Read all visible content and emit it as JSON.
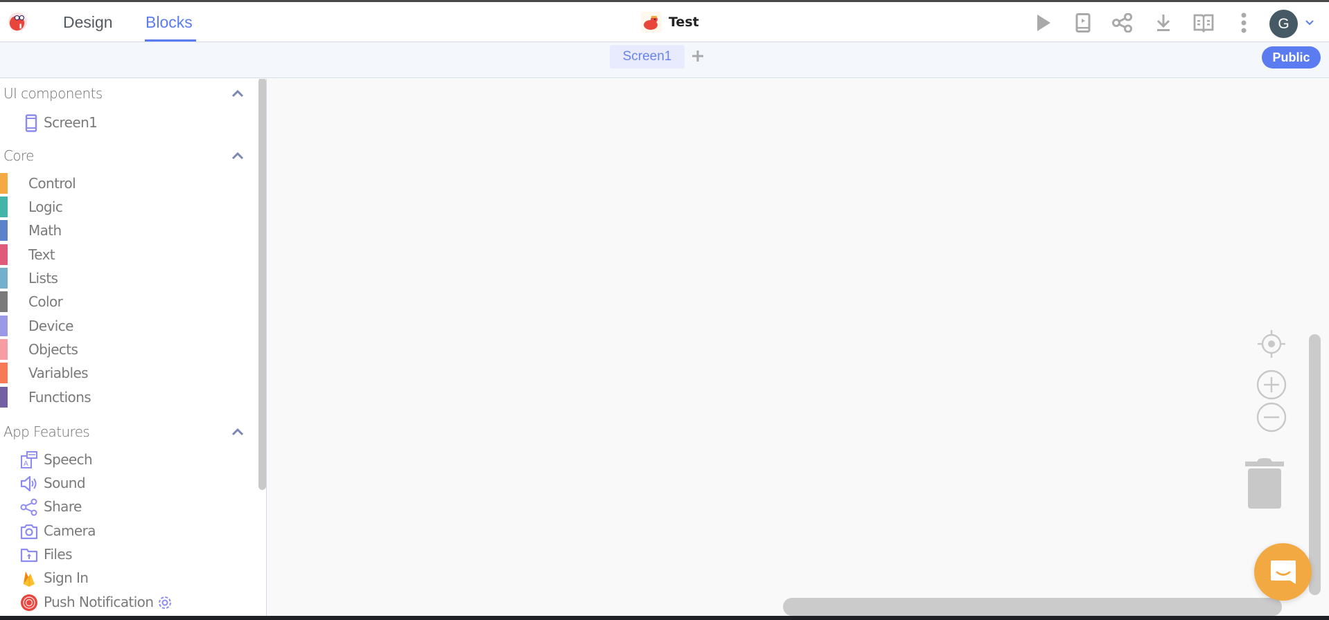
{
  "header": {
    "nav_tabs": [
      {
        "label": "Design",
        "active": false
      },
      {
        "label": "Blocks",
        "active": true
      }
    ],
    "project_title": "Test",
    "toolbar_icons": [
      "play-icon",
      "device-preview-icon",
      "share-icon",
      "download-icon",
      "docs-book-icon",
      "more-vert-icon"
    ],
    "user_avatar_initial": "G",
    "accent_color": "#5b7cf0"
  },
  "screenbar": {
    "screens": [
      {
        "label": "Screen1",
        "active": true
      }
    ],
    "add_screen_symbol": "+",
    "visibility_badge": "Public"
  },
  "sidebar": {
    "ui_components": {
      "title": "UI components",
      "items": [
        {
          "label": "Screen1",
          "icon": "phone-screen-icon"
        }
      ]
    },
    "core": {
      "title": "Core",
      "items": [
        {
          "label": "Control",
          "color": "#f5a942"
        },
        {
          "label": "Logic",
          "color": "#42b4a8"
        },
        {
          "label": "Math",
          "color": "#5c82c9"
        },
        {
          "label": "Text",
          "color": "#e05a7a"
        },
        {
          "label": "Lists",
          "color": "#72b0cb"
        },
        {
          "label": "Color",
          "color": "#7a7a7a"
        },
        {
          "label": "Device",
          "color": "#9999e8"
        },
        {
          "label": "Objects",
          "color": "#f79ba4"
        },
        {
          "label": "Variables",
          "color": "#f77a56"
        },
        {
          "label": "Functions",
          "color": "#7360a4"
        }
      ]
    },
    "app_features": {
      "title": "App Features",
      "items": [
        {
          "label": "Speech",
          "icon": "speech-icon"
        },
        {
          "label": "Sound",
          "icon": "sound-icon"
        },
        {
          "label": "Share",
          "icon": "share-icon"
        },
        {
          "label": "Camera",
          "icon": "camera-icon"
        },
        {
          "label": "Files",
          "icon": "files-icon"
        },
        {
          "label": "Sign In",
          "icon": "firebase-icon"
        },
        {
          "label": "Push Notification",
          "icon": "push-notification-icon",
          "has_settings": true
        }
      ]
    }
  },
  "workspace": {
    "controls": [
      "recenter-icon",
      "zoom-in-icon",
      "zoom-out-icon",
      "trash-icon"
    ],
    "chat_color": "#f3a941"
  }
}
